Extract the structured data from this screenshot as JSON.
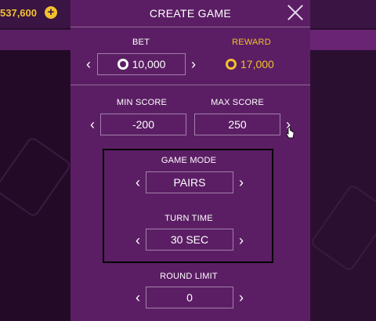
{
  "background": {
    "balance": "537,600",
    "add_icon": "plus-circle-icon"
  },
  "modal": {
    "title": "CREATE GAME",
    "close_icon": "close-icon",
    "bet": {
      "label": "BET",
      "value": "10,000",
      "icon": "chip-icon"
    },
    "reward": {
      "label": "REWARD",
      "value": "17,000",
      "icon": "gold-chip-icon"
    },
    "min_score": {
      "label": "MIN SCORE",
      "value": "-200"
    },
    "max_score": {
      "label": "MAX SCORE",
      "value": "250"
    },
    "game_mode": {
      "label": "GAME MODE",
      "value": "PAIRS"
    },
    "turn_time": {
      "label": "TURN TIME",
      "value": "30 SEC"
    },
    "round_limit": {
      "label": "ROUND LIMIT",
      "value": "0"
    },
    "arrows": {
      "left": "‹",
      "right": "›"
    }
  },
  "colors": {
    "modal_bg": "#5b1e64",
    "accent_gold": "#f2c12e",
    "page_bg": "#2a0f2e"
  }
}
